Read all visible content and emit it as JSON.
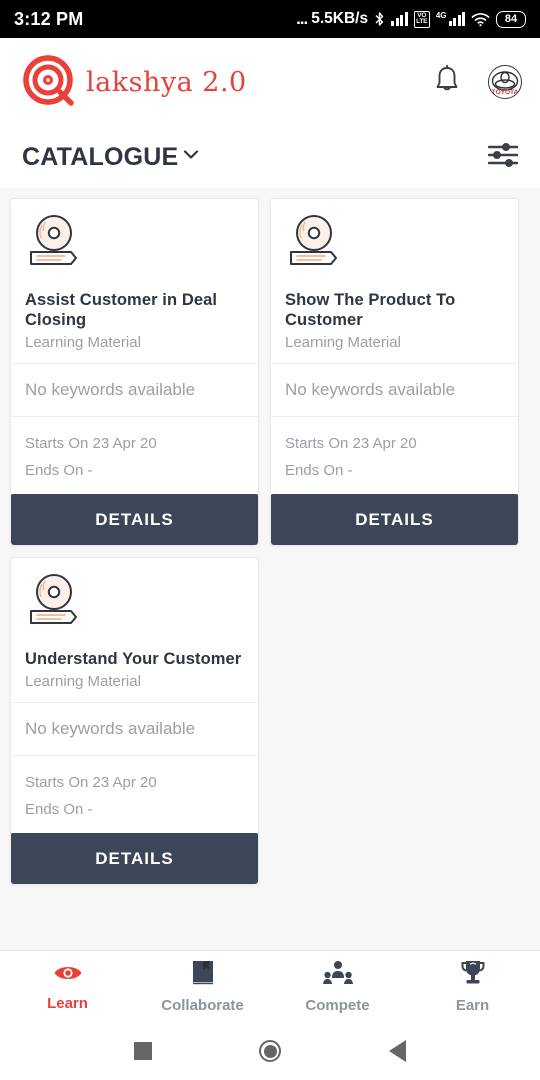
{
  "statusbar": {
    "time": "3:12 PM",
    "dots": "...",
    "network_speed": "5.5KB/s",
    "bluetooth_icon": "bluetooth-icon",
    "volte_line1": "VO",
    "volte_line2": "LTE",
    "network_type": "4G",
    "wifi_icon": "wifi-icon",
    "battery": "84"
  },
  "header": {
    "logo_icon": "target-bullseye-icon",
    "brand": "lakshya 2.0",
    "notification_icon": "bell-icon",
    "avatar_icon": "toyota-logo-avatar"
  },
  "catalogue": {
    "title": "CATALOGUE",
    "chevron_icon": "chevron-down-icon",
    "filter_icon": "filter-sliders-icon"
  },
  "cards": [
    {
      "icon": "disc-on-book-icon",
      "title": "Assist Customer in Deal Closing",
      "subtitle": "Learning Material",
      "keywords": "No keywords available",
      "starts_on": "Starts On 23 Apr 20",
      "ends_on": "Ends On -",
      "button": "DETAILS"
    },
    {
      "icon": "disc-on-book-icon",
      "title": "Show The Product To Customer",
      "subtitle": "Learning Material",
      "keywords": "No keywords available",
      "starts_on": "Starts On 23 Apr 20",
      "ends_on": "Ends On -",
      "button": "DETAILS"
    },
    {
      "icon": "disc-on-book-icon",
      "title": "Understand Your Customer",
      "subtitle": "Learning Material",
      "keywords": "No keywords available",
      "starts_on": "Starts On 23 Apr 20",
      "ends_on": "Ends On -",
      "button": "DETAILS"
    }
  ],
  "bottomnav": {
    "items": [
      {
        "label": "Learn",
        "icon": "eye-icon",
        "active": true
      },
      {
        "label": "Collaborate",
        "icon": "book-icon",
        "active": false
      },
      {
        "label": "Compete",
        "icon": "people-group-icon",
        "active": false
      },
      {
        "label": "Earn",
        "icon": "trophy-icon",
        "active": false
      }
    ]
  },
  "sysnav": {
    "recents_icon": "square-recents-icon",
    "home_icon": "circle-home-icon",
    "back_icon": "triangle-back-icon"
  },
  "colors": {
    "accent": "#e8413a",
    "button": "#3d4558",
    "text_dark": "#2f3542",
    "text_muted": "#9aa0a6",
    "background": "#f7f7f7"
  }
}
